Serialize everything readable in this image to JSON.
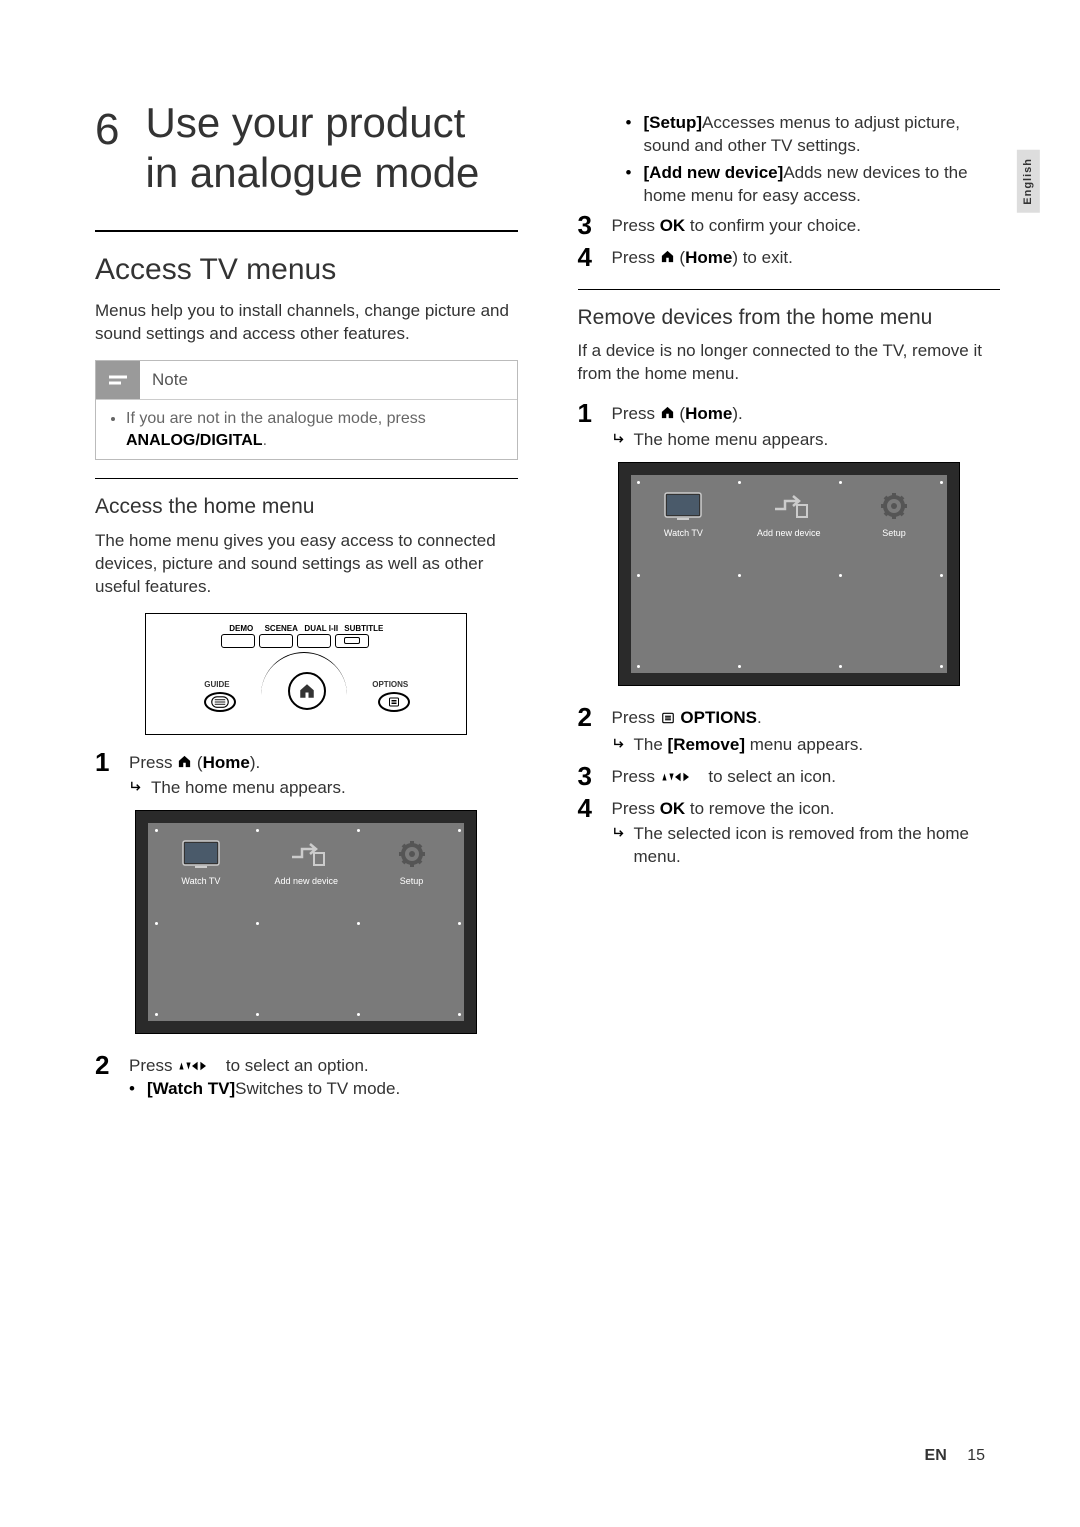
{
  "language_tab": "English",
  "chapter_num": "6",
  "chapter_title_line1": "Use your product",
  "chapter_title_line2": "in analogue mode",
  "section1": {
    "heading": "Access TV menus",
    "intro": "Menus help you to install channels, change picture and sound settings and access other features."
  },
  "note": {
    "label": "Note",
    "text_pre": "If you are not in the analogue mode, press ",
    "text_bold": "ANALOG/DIGITAL",
    "text_post": "."
  },
  "sub1": {
    "heading": "Access the home menu",
    "intro": "The home menu gives you easy access to connected devices, picture and sound settings as well as other useful features."
  },
  "remote_labels": {
    "demo": "DEMO",
    "scenea": "SCENEA",
    "dual": "DUAL I-II",
    "subtitle": "SUBTITLE",
    "guide": "GUIDE",
    "options": "OPTIONS"
  },
  "tv_menu": {
    "watch_tv": "Watch TV",
    "add_new_device": "Add new device",
    "setup": "Setup"
  },
  "steps_access": {
    "s1_pre": "Press ",
    "s1_home": "Home",
    "s1_post": ".",
    "s1_result": "The home menu appears.",
    "s2_pre": "Press ",
    "s2_post": " to select an option.",
    "s2_b1_bold": "[Watch TV]",
    "s2_b1_text": "Switches to TV mode.",
    "s2_b2_bold": "[Setup]",
    "s2_b2_text": "Accesses menus to adjust picture, sound and other TV settings.",
    "s2_b3_bold": "[Add new device]",
    "s2_b3_text": "Adds new devices to the home menu for easy access.",
    "s3_pre": "Press ",
    "s3_ok": "OK",
    "s3_post": " to confirm your choice.",
    "s4_pre": "Press ",
    "s4_home": "Home",
    "s4_post": " to exit."
  },
  "sub2": {
    "heading": "Remove devices from the home menu",
    "intro": "If a device is no longer connected to the TV, remove it from the home menu."
  },
  "steps_remove": {
    "s1_pre": "Press ",
    "s1_home": "Home",
    "s1_post": ".",
    "s1_result": "The home menu appears.",
    "s2_pre": "Press ",
    "s2_options": "OPTIONS",
    "s2_post": ".",
    "s2_result_pre": "The ",
    "s2_result_bold": "[Remove]",
    "s2_result_post": " menu appears.",
    "s3_pre": "Press ",
    "s3_post": " to select an icon.",
    "s4_pre": "Press ",
    "s4_ok": "OK",
    "s4_post": " to remove the icon.",
    "s4_result": "The selected icon is removed from the home menu."
  },
  "footer": {
    "lang": "EN",
    "page": "15"
  }
}
